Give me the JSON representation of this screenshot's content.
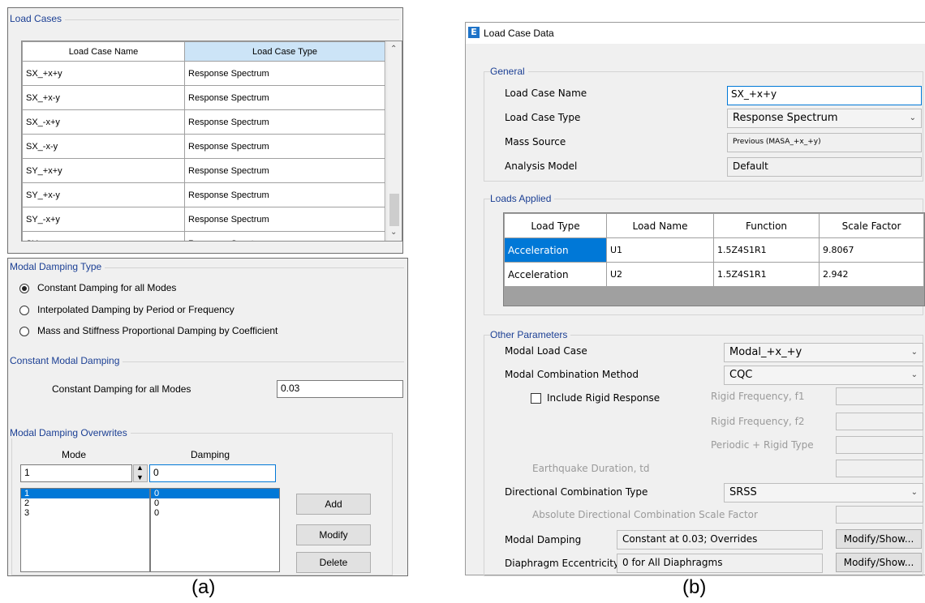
{
  "a": {
    "load_cases": {
      "title": "Load Cases",
      "headers": [
        "Load Case Name",
        "Load Case Type"
      ],
      "rows": [
        [
          "SX_+x+y",
          "Response Spectrum"
        ],
        [
          "SX_+x-y",
          "Response Spectrum"
        ],
        [
          "SX_-x+y",
          "Response Spectrum"
        ],
        [
          "SX_-x-y",
          "Response Spectrum"
        ],
        [
          "SY_+x+y",
          "Response Spectrum"
        ],
        [
          "SY_+x-y",
          "Response Spectrum"
        ],
        [
          "SY_-x+y",
          "Response Spectrum"
        ],
        [
          "SY_-x-y",
          "Response Spectrum"
        ]
      ]
    },
    "damping_type": {
      "title": "Modal Damping Type",
      "options": [
        "Constant Damping for all Modes",
        "Interpolated Damping by Period or Frequency",
        "Mass and Stiffness Proportional Damping by Coefficient"
      ],
      "selected_index": 0
    },
    "constant_damping": {
      "title": "Constant Modal Damping",
      "label": "Constant Damping for all Modes",
      "value": "0.03"
    },
    "overwrites": {
      "title": "Modal Damping Overwrites",
      "mode_header": "Mode",
      "damping_header": "Damping",
      "mode_value": "1",
      "damping_value": "0",
      "list": [
        {
          "mode": "1",
          "damping": "0"
        },
        {
          "mode": "2",
          "damping": "0"
        },
        {
          "mode": "3",
          "damping": "0"
        }
      ],
      "buttons": {
        "add": "Add",
        "modify": "Modify",
        "delete": "Delete"
      }
    },
    "caption": "(a)"
  },
  "b": {
    "window_title": "Load Case Data",
    "app_icon": "E",
    "general": {
      "title": "General",
      "name_label": "Load Case Name",
      "name_value": "SX_+x+y",
      "type_label": "Load Case Type",
      "type_value": "Response Spectrum",
      "mass_label": "Mass Source",
      "mass_value": "Previous  (MASA_+x_+y)",
      "model_label": "Analysis Model",
      "model_value": "Default"
    },
    "loads_applied": {
      "title": "Loads Applied",
      "headers": [
        "Load Type",
        "Load Name",
        "Function",
        "Scale Factor"
      ],
      "rows": [
        [
          "Acceleration",
          "U1",
          "1.5Z4S1R1",
          "9.8067"
        ],
        [
          "Acceleration",
          "U2",
          "1.5Z4S1R1",
          "2.942"
        ]
      ]
    },
    "other": {
      "title": "Other Parameters",
      "modal_case_label": "Modal Load Case",
      "modal_case_value": "Modal_+x_+y",
      "combo_method_label": "Modal Combination Method",
      "combo_method_value": "CQC",
      "rigid_response_label": "Include Rigid Response",
      "rigid_f1_label": "Rigid Frequency, f1",
      "rigid_f2_label": "Rigid Frequency, f2",
      "periodic_label": "Periodic + Rigid Type",
      "eq_duration_label": "Earthquake Duration, td",
      "dir_combo_label": "Directional Combination Type",
      "dir_combo_value": "SRSS",
      "abs_dir_label": "Absolute Directional Combination Scale Factor",
      "modal_damping_label": "Modal Damping",
      "modal_damping_value": "Constant at 0.03; Overrides",
      "diaphragm_label": "Diaphragm Eccentricity",
      "diaphragm_value": "0 for All Diaphragms",
      "modify_show": "Modify/Show..."
    },
    "caption": "(b)"
  }
}
